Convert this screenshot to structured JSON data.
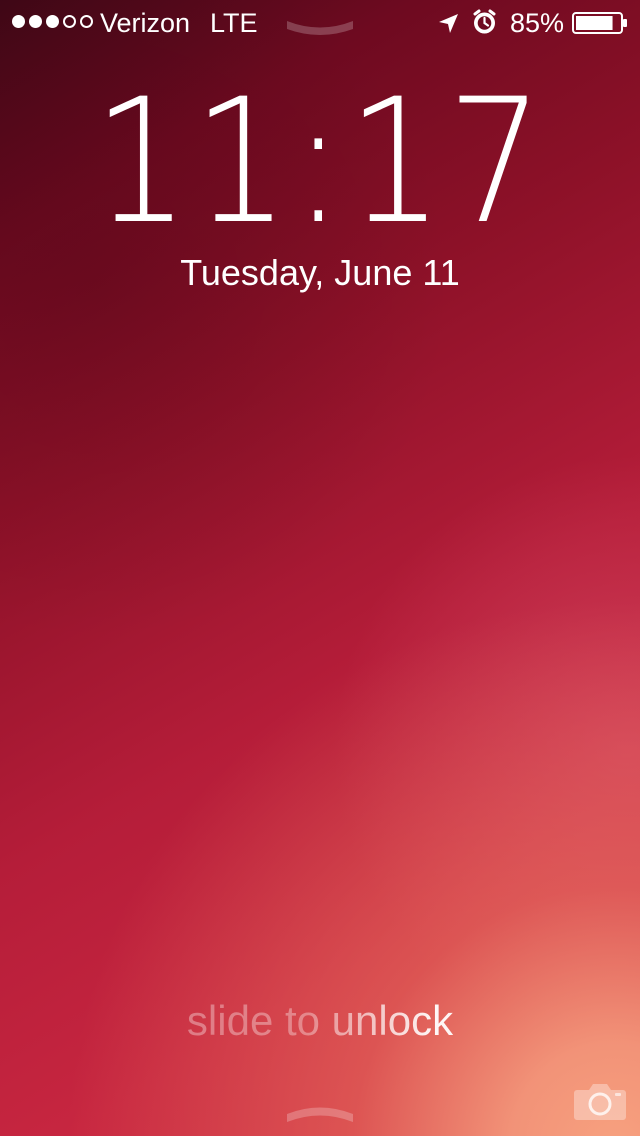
{
  "status_bar": {
    "signal_strength": {
      "filled": 3,
      "total": 5
    },
    "carrier": "Verizon",
    "network": "LTE",
    "battery_percent": "85%",
    "battery_level": 0.85,
    "icons": {
      "location": "location-arrow-icon",
      "alarm": "alarm-clock-icon",
      "battery": "battery-icon"
    }
  },
  "lock_screen": {
    "time": "11:17",
    "date": "Tuesday, June 11",
    "slide_text": "slide to unlock",
    "top_handle": "notification-center-handle",
    "bottom_handle": "control-center-handle",
    "camera_icon": "camera-icon"
  },
  "colors": {
    "wallpaper_dark": "#3f0716",
    "wallpaper_red": "#b51d39",
    "wallpaper_peach": "#f7a17f",
    "text": "#ffffff"
  }
}
